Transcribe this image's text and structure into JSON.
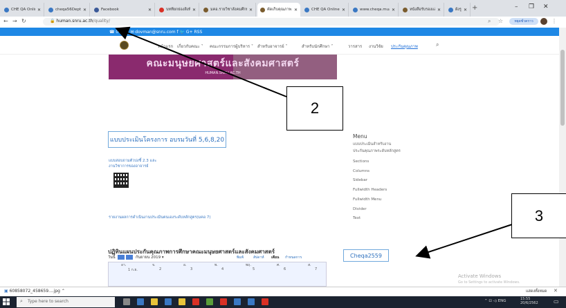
{
  "browser": {
    "tabs": [
      {
        "title": "CHE QA Online Syst",
        "color": "#3a78c3"
      },
      {
        "title": "cheqa56Dept.pdf",
        "color": "#3a78c3"
      },
      {
        "title": "Facebook",
        "color": "#3b5998"
      },
      {
        "title": "บทที่ยกย่องสิ่งที่แยก",
        "color": "#d93025"
      },
      {
        "title": "มคอ.รายวิชาสังคมศึกษ์",
        "color": "#7a5c2e"
      },
      {
        "title": "คัดเก็บคุณภาพ | คณะ",
        "color": "#7a5c2e"
      },
      {
        "title": "CHE QA Online Syst",
        "color": "#3a78c3"
      },
      {
        "title": "www.cheqa.mua.go",
        "color": "#3a78c3"
      },
      {
        "title": "หนังสือรับรองแล้ว",
        "color": "#7a5c2e"
      },
      {
        "title": "ผังรูปแบบ/SBSQAc",
        "color": "#3a78c3"
      }
    ],
    "active_tab_index": 5,
    "url_host": "human.snru.ac.th",
    "url_path": "/quality/",
    "profile_label": "หยุดชั่วคราว"
  },
  "site": {
    "topbar_text": "☎ 0 .......   ✉ dovman@snru.com   f   🐦   G+   RSS",
    "menu": [
      "หน้าแรก",
      "เกี่ยวกับคณะ ˅",
      "คณะกรรมการผู้บริหาร ˅",
      "สำหรับอาจารย์ ˅",
      "สำหรับนักศึกษา ˅",
      "วารสาร",
      "งานวิจัย",
      "ประกันคุณภาพ"
    ],
    "banner_title": "คณะมนุษยศาสตร์และสังคมศาสตร์",
    "banner_sub": "HUMAN.SNRU.AC.TH",
    "left_button": "แบบประเมินโครงการ อบรมวันที่ 5,6,8,20",
    "left_link1": "แบบสอบถามตัวบ่งชี้ 2.3 และ",
    "left_link2": "งานวิชาการของอาจารย์",
    "left_link3": "รายงานผลการดำเนินงานประเมินตนเองระดับหลักสูตร(มคอ 7)",
    "sidebar_heading": "Menu",
    "sidebar_items": [
      "แบบประเมินสำหรับงาน",
      "ประกันคุณภาพระดับหลักสูตร",
      "Sections",
      "Columns",
      "Sidebar",
      "Fullwidth Headers",
      "Fullwidth Menu",
      "Divider",
      "Text"
    ],
    "calendar_title": "ปฏิทินแผนประกันคุณภาพการศึกษาคณะมนุษยศาสตร์และสังคมศาสตร์",
    "calendar_month": "กันยายน 2019 ▾",
    "calendar_today": "วันนี้",
    "calendar_views": [
      "พิมพ์",
      "สัปดาห์",
      "เดือน",
      "กำหนดการ"
    ],
    "calendar_days": [
      "อา.",
      "จ.",
      "อ.",
      "พ.",
      "พฤ.",
      "ศ.",
      "ส."
    ],
    "calendar_dates": [
      "1 ก.ย.",
      "2",
      "3",
      "4",
      "5",
      "6",
      "7"
    ],
    "cheqa_button": "Cheqa2559",
    "activate_title": "Activate Windows",
    "activate_sub": "Go to Settings to activate Windows."
  },
  "annotations": {
    "callout_2": "2",
    "callout_3": "3"
  },
  "downloads": {
    "file": "60858072_458659....jpg",
    "show_all": "แสดงทั้งหมด"
  },
  "taskbar": {
    "search_placeholder": "Type here to search",
    "clock": "15:55\n20/6/2562"
  }
}
